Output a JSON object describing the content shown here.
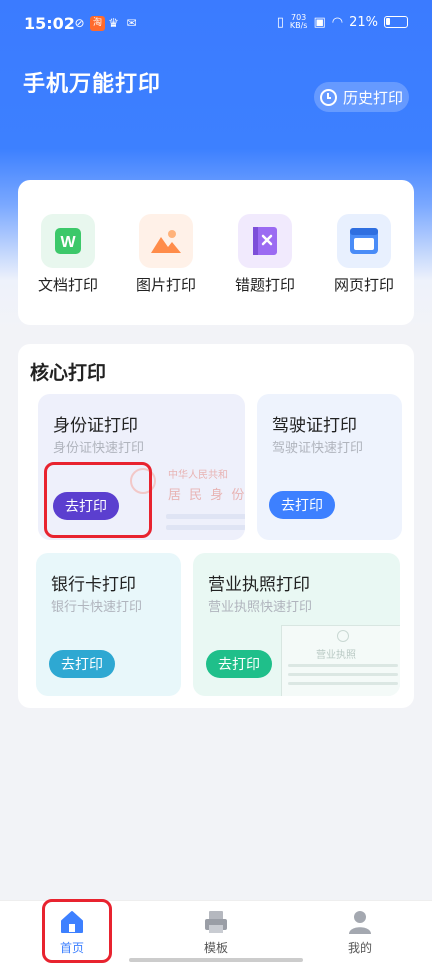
{
  "status": {
    "time": "15:02",
    "net_speed_top": "703",
    "net_speed_bottom": "KB/s",
    "battery": "21%"
  },
  "header": {
    "title": "手机万能打印",
    "history_label": "历史打印"
  },
  "tools": [
    {
      "label": "文档打印",
      "icon": "word-doc-icon",
      "color": "#3cc86a"
    },
    {
      "label": "图片打印",
      "icon": "image-icon",
      "color": "#ff8c4a"
    },
    {
      "label": "错题打印",
      "icon": "wrong-question-book-icon",
      "color": "#9b6bf2"
    },
    {
      "label": "网页打印",
      "icon": "webpage-icon",
      "color": "#4a8cf7"
    }
  ],
  "core": {
    "title": "核心打印",
    "cards": [
      {
        "title": "身份证打印",
        "subtitle": "身份证快速打印",
        "button": "去打印",
        "button_color": "#5b3fcf",
        "deco_line1": "中华人民共和",
        "deco_line2": "居 民 身 份"
      },
      {
        "title": "驾驶证打印",
        "subtitle": "驾驶证快速打印",
        "button": "去打印",
        "button_color": "#3d80ff"
      },
      {
        "title": "银行卡打印",
        "subtitle": "银行卡快速打印",
        "button": "去打印",
        "button_color": "#2ea8d2"
      },
      {
        "title": "营业执照打印",
        "subtitle": "营业执照快速打印",
        "button": "去打印",
        "button_color": "#1fbf8a",
        "deco_label": "营业执照"
      }
    ]
  },
  "tabbar": [
    {
      "label": "首页",
      "active": true,
      "icon": "home-icon"
    },
    {
      "label": "模板",
      "active": false,
      "icon": "template-icon"
    },
    {
      "label": "我的",
      "active": false,
      "icon": "profile-icon"
    }
  ],
  "colors": {
    "primary": "#3d80ff",
    "highlight": "#e8232f"
  }
}
